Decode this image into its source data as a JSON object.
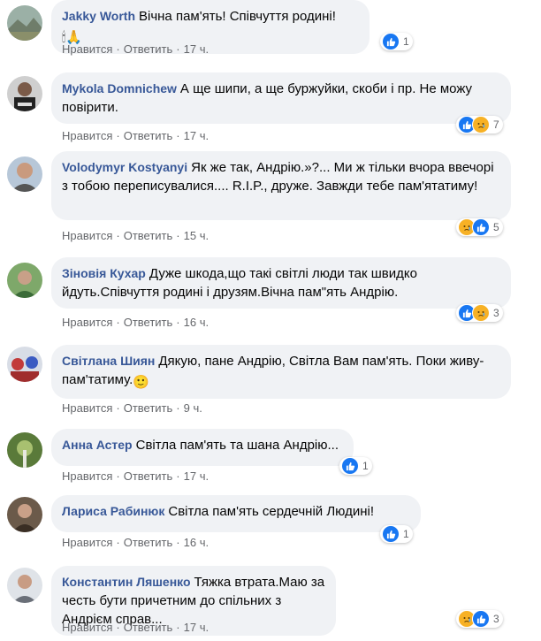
{
  "labels": {
    "like": "Нравится",
    "reply": "Ответить",
    "dot": "·"
  },
  "colors": {
    "author": "#385898",
    "bubble": "#f0f2f5",
    "like": "#1877f2",
    "sad": "#f7b125"
  },
  "comments": [
    {
      "author": "Jakky Worth",
      "text": "Вічна пам'ять! Співчуття родині! ",
      "emoji": "🕯🙏",
      "time": "17 ч.",
      "reactions": [
        "like"
      ],
      "count": "1",
      "avatar": "landscape"
    },
    {
      "author": "Mykola Domnichew",
      "text": "А ще шипи, а ще буржуйки, скоби і пр. Не можу повірити.",
      "time": "17 ч.",
      "reactions": [
        "like",
        "sad"
      ],
      "count": "7",
      "avatar": "person-dark"
    },
    {
      "author": "Volodymyr Kostyanyi",
      "text": "Як же так, Андрію.»?... Ми ж тільки вчора ввечорі з тобою переписувалися.... R.I.P., друже. Завжди тебе пам'ятатиму!",
      "time": "15 ч.",
      "reactions": [
        "sad",
        "like"
      ],
      "count": "5",
      "avatar": "person-grey"
    },
    {
      "author": "Зіновія Кухар",
      "text": "Дуже шкода,що такі світлі люди так швидко йдуть.Співчуття родині і друзям.Вічна пам\"ять Андрію.",
      "time": "16 ч.",
      "reactions": [
        "like",
        "sad"
      ],
      "count": "3",
      "avatar": "person-green"
    },
    {
      "author": "Світлана Шиян",
      "text": "Дякую, пане Андрію, Світла Вам пам'ять. Поки живу- пам'татиму.",
      "emoji": "🙂",
      "time": "9 ч.",
      "reactions": [],
      "count": "",
      "avatar": "group-red"
    },
    {
      "author": "Анна Астер",
      "text": "Світла пам'ять та шана Андрію...",
      "time": "17 ч.",
      "reactions": [
        "like"
      ],
      "count": "1",
      "avatar": "nature"
    },
    {
      "author": "Лариса Рабинюк",
      "text": "Світла пам'ять сердечній Людині!",
      "time": "16 ч.",
      "reactions": [
        "like"
      ],
      "count": "1",
      "avatar": "person-brown"
    },
    {
      "author": "Константин Ляшенко",
      "text": "Тяжка втрата.Маю за честь бути причетним до спільних з Андрієм справ...",
      "time": "17 ч.",
      "reactions": [
        "sad",
        "like"
      ],
      "count": "3",
      "avatar": "person-grey2"
    }
  ]
}
